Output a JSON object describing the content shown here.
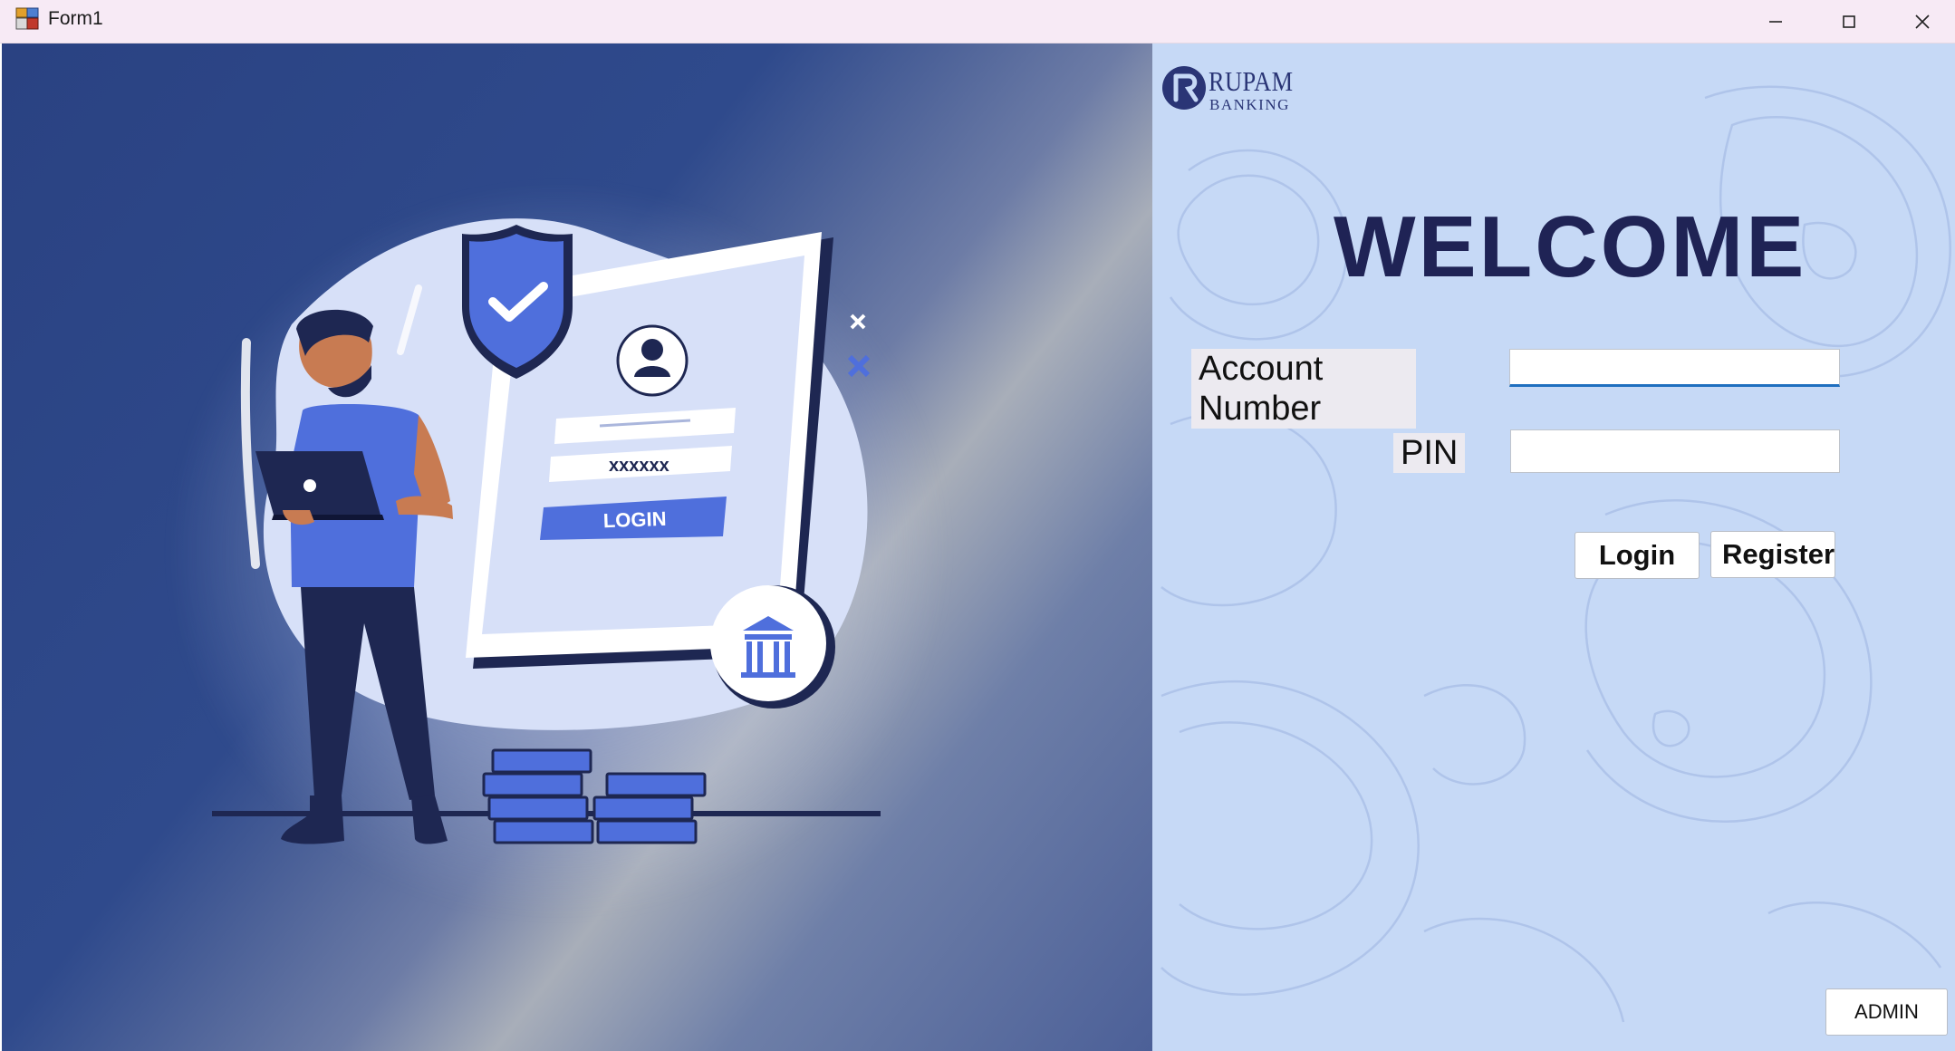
{
  "window": {
    "title": "Form1",
    "icon": "winforms-app-icon",
    "controls": [
      "minimize-icon",
      "maximize-icon",
      "close-icon"
    ]
  },
  "illustration": {
    "icon": "online-banking-login-illustration",
    "password_mask": "xxxxxx",
    "login_label": "LOGIN"
  },
  "logo": {
    "name": "RUPAM",
    "subtitle": "BANKING",
    "icon": "r-logo-icon"
  },
  "form": {
    "heading": "WELCOME",
    "account_label": "Account Number",
    "account_value": "",
    "pin_label": "PIN",
    "pin_value": "",
    "login_button": "Login",
    "register_button": "Register",
    "admin_button": "ADMIN"
  },
  "colors": {
    "heading": "#1f2355",
    "left_panel": "#2f4a8c",
    "right_panel": "#c6d9f6",
    "accent": "#4f6fdc",
    "input_focus": "#1f6fbf"
  }
}
